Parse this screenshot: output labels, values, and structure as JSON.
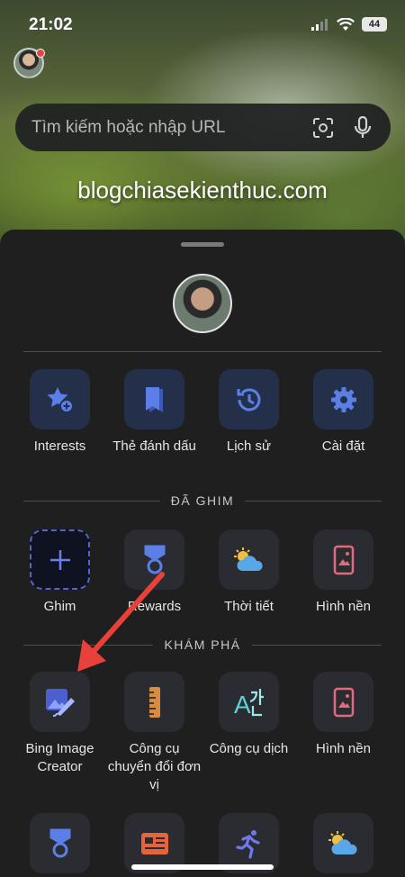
{
  "status": {
    "time": "21:02",
    "battery": "44"
  },
  "search": {
    "placeholder": "Tìm kiếm hoặc nhập URL"
  },
  "watermark": "blogchiasekienthuc.com",
  "quick_actions": [
    {
      "label": "Interests",
      "icon": "star-plus-icon"
    },
    {
      "label": "Thẻ đánh dấu",
      "icon": "bookmark-icon"
    },
    {
      "label": "Lịch sử",
      "icon": "history-icon"
    },
    {
      "label": "Cài đặt",
      "icon": "gear-icon"
    }
  ],
  "pinned": {
    "title": "ĐÃ GHIM",
    "items": [
      {
        "label": "Ghim",
        "icon": "plus-icon"
      },
      {
        "label": "Rewards",
        "icon": "medal-icon"
      },
      {
        "label": "Thời tiết",
        "icon": "weather-icon"
      },
      {
        "label": "Hình nền",
        "icon": "wallpaper-icon"
      }
    ]
  },
  "discover": {
    "title": "KHÁM PHÁ",
    "items": [
      {
        "label": "Bing Image Creator",
        "icon": "image-creator-icon"
      },
      {
        "label": "Công cụ chuyển đổi đơn vị",
        "icon": "ruler-icon"
      },
      {
        "label": "Công cụ dịch",
        "icon": "translate-icon"
      },
      {
        "label": "Hình nền",
        "icon": "wallpaper-icon"
      }
    ],
    "row2": [
      {
        "icon": "medal-icon"
      },
      {
        "icon": "news-icon"
      },
      {
        "icon": "runner-icon"
      },
      {
        "icon": "weather-icon"
      }
    ]
  },
  "colors": {
    "accent_blue": "#5b7fe6",
    "arrow_red": "#e8413a",
    "wallpaper_pink": "#e36a7a",
    "ruler_orange": "#d98c3e",
    "translate_teal": "#5fd0d6"
  }
}
